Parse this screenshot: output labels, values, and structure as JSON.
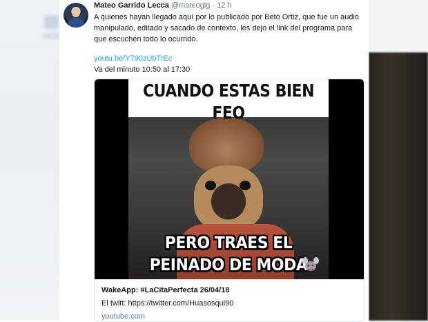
{
  "tweet": {
    "author_name": "Mateo Garrido Lecca",
    "handle": "@mateoglg",
    "separator": "·",
    "time": "12 h",
    "text": "A quienes hayan llegado aquí por lo publicado por Beto Ortiz, que fue un audio manipulado, editado y sacado de contexto, les dejo el link del programa para que escuchen todo lo ocurrido.",
    "link": "youtu.be/Y790zUbTrEc",
    "minute_note": "Va del minuto 10:50 al 17:30"
  },
  "media": {
    "meme_top_text": "CUANDO ESTAS BIEN FEO",
    "meme_bottom_text": "PERO TRAES EL PEINADO DE MODA",
    "corner_icon": "mascot-icon"
  },
  "link_card": {
    "title": "WakeApp: #LaCitaPerfecta 26/04/18",
    "description": "El twitt: https://twitter.com/Huasosqui90",
    "domain": "youtube.com"
  },
  "colors": {
    "link": "#1da1f2",
    "meta_gray": "#657786",
    "text": "#14171a",
    "border": "#e1e8ed"
  }
}
